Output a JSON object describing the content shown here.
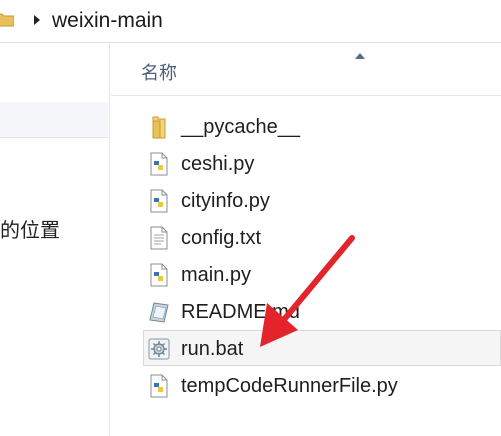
{
  "address_bar": {
    "path": "weixin-main"
  },
  "navigation_pane": {
    "visible_text": "的位置"
  },
  "file_list": {
    "column_header": "名称",
    "items": [
      {
        "name": "__pycache__",
        "icon": "folder-icon"
      },
      {
        "name": "ceshi.py",
        "icon": "python-file-icon"
      },
      {
        "name": "cityinfo.py",
        "icon": "python-file-icon"
      },
      {
        "name": "config.txt",
        "icon": "text-file-icon"
      },
      {
        "name": "main.py",
        "icon": "python-file-icon"
      },
      {
        "name": "README.md",
        "icon": "markdown-file-icon"
      },
      {
        "name": "run.bat",
        "icon": "batch-file-icon",
        "selected": true
      },
      {
        "name": "tempCodeRunnerFile.py",
        "icon": "python-file-icon"
      }
    ]
  },
  "colors": {
    "annotation_arrow": "#e3242b",
    "header_text": "#4c607a",
    "selected_row_bg": "#f5f5f5",
    "folder_yellow": "#e8c15a"
  }
}
